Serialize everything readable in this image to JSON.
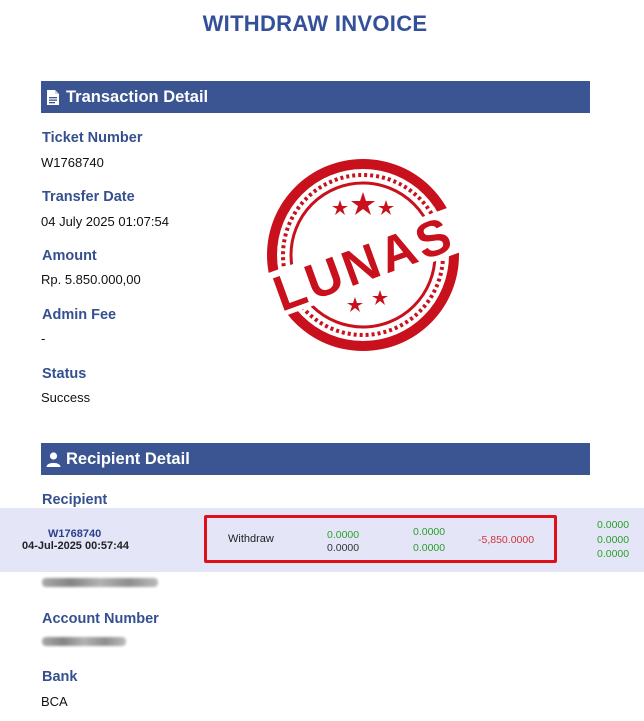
{
  "title": "WITHDRAW INVOICE",
  "transaction_section": {
    "heading": "Transaction Detail",
    "icon": "document-icon",
    "fields": {
      "ticket_number": {
        "label": "Ticket Number",
        "value": "W1768740"
      },
      "transfer_date": {
        "label": "Transfer Date",
        "value": "04 July 2025 01:07:54"
      },
      "amount": {
        "label": "Amount",
        "value": "Rp. 5.850.000,00"
      },
      "admin_fee": {
        "label": "Admin Fee",
        "value": "-"
      },
      "status": {
        "label": "Status",
        "value": "Success"
      }
    }
  },
  "stamp": {
    "text": "LUNAS",
    "color": "#c8111c"
  },
  "recipient_section": {
    "heading": "Recipient Detail",
    "icon": "user-icon",
    "fields": {
      "recipient": {
        "label": "Recipient"
      },
      "account_number": {
        "label": "Account Number"
      },
      "bank": {
        "label": "Bank",
        "value": "BCA"
      }
    }
  },
  "overlay_row": {
    "ticket": "W1768740",
    "datetime": "04-Jul-2025 00:57:44",
    "type": "Withdraw",
    "col1": [
      "0.0000",
      "0.0000"
    ],
    "col2": [
      "0.0000",
      "0.0000"
    ],
    "amount": "-5,850.0000",
    "col3": [
      "0.0000",
      "0.0000",
      "0.0000"
    ],
    "highlight_color": "#e0101b"
  }
}
